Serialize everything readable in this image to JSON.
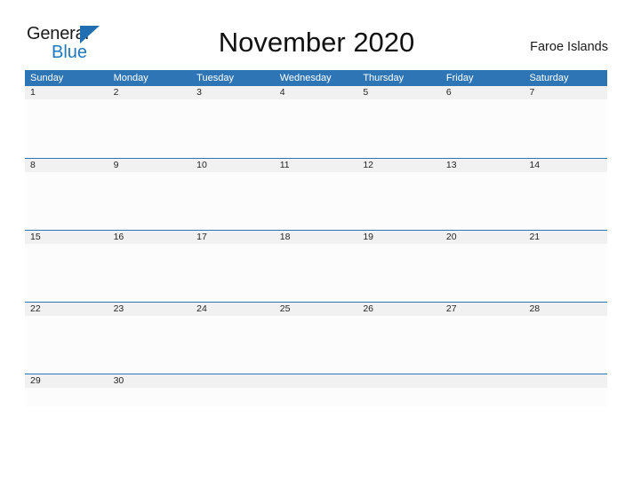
{
  "brand": {
    "name_part1": "General",
    "name_part2": "Blue",
    "triangle_icon": "triangle-icon",
    "color_dark": "#1a1a1a",
    "color_blue": "#1F78BE"
  },
  "header": {
    "title": "November 2020",
    "region": "Faroe Islands"
  },
  "theme": {
    "header_blue": "#2E75B6",
    "date_strip_gray": "#F1F1F1",
    "cell_white": "#FCFCFD",
    "text_dark": "#252525",
    "text_white": "#ffffff"
  },
  "calendar": {
    "month": "November",
    "year": "2020",
    "weekdays": [
      "Sunday",
      "Monday",
      "Tuesday",
      "Wednesday",
      "Thursday",
      "Friday",
      "Saturday"
    ],
    "weeks": [
      {
        "days": [
          "1",
          "2",
          "3",
          "4",
          "5",
          "6",
          "7"
        ]
      },
      {
        "days": [
          "8",
          "9",
          "10",
          "11",
          "12",
          "13",
          "14"
        ]
      },
      {
        "days": [
          "15",
          "16",
          "17",
          "18",
          "19",
          "20",
          "21"
        ]
      },
      {
        "days": [
          "22",
          "23",
          "24",
          "25",
          "26",
          "27",
          "28"
        ]
      },
      {
        "days": [
          "29",
          "30",
          "",
          "",
          "",
          "",
          ""
        ]
      }
    ]
  }
}
